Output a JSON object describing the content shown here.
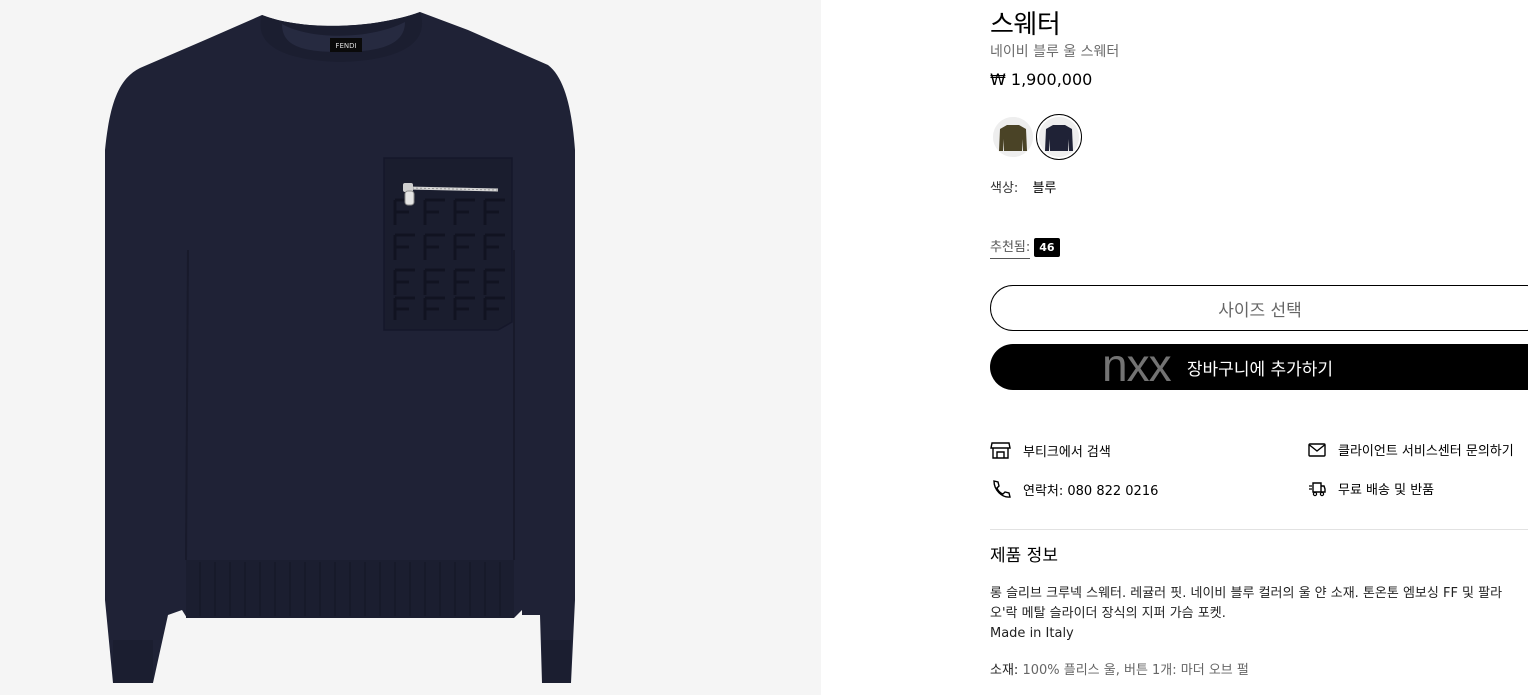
{
  "product": {
    "title": "스웨터",
    "subtitle": "네이비 블루 울 스웨터",
    "price": "₩ 1,900,000"
  },
  "swatches": [
    {
      "name": "올리브",
      "color": "#4a4326",
      "selected": false
    },
    {
      "name": "블루",
      "color": "#1f2236",
      "selected": true
    }
  ],
  "color": {
    "label": "색상:",
    "value": "블루"
  },
  "recommended": {
    "label": "추천됨:",
    "count": "46"
  },
  "buttons": {
    "size_select": "사이즈 선택",
    "add_to_cart": "장바구니에 추가하기"
  },
  "watermark": "nxx",
  "services": {
    "boutique": "부티크에서 검색",
    "client_service": "클라이언트 서비스센터 문의하기",
    "contact": "연락처: 080 822 0216",
    "shipping": "무료 배송 및 반품"
  },
  "info": {
    "section_title": "제품 정보",
    "desc_line1": "롱 슬리브 크루넥 스웨터. 레귤러 핏. 네이비 블루 컬러의 울 얀 소재. 톤온톤 엠보싱 FF 및 팔라",
    "desc_line2": "오'락 메탈 슬라이더 장식의 지퍼 가슴 포켓.",
    "made_in": "Made in Italy",
    "material_label": "소재:",
    "material_value": "100% 플리스 울, 버튼 1개: 마더 오브 펄"
  },
  "image": {
    "brand_label": "FENDI",
    "sweater_color": "#1f2236",
    "bg_color": "#f5f5f5"
  }
}
